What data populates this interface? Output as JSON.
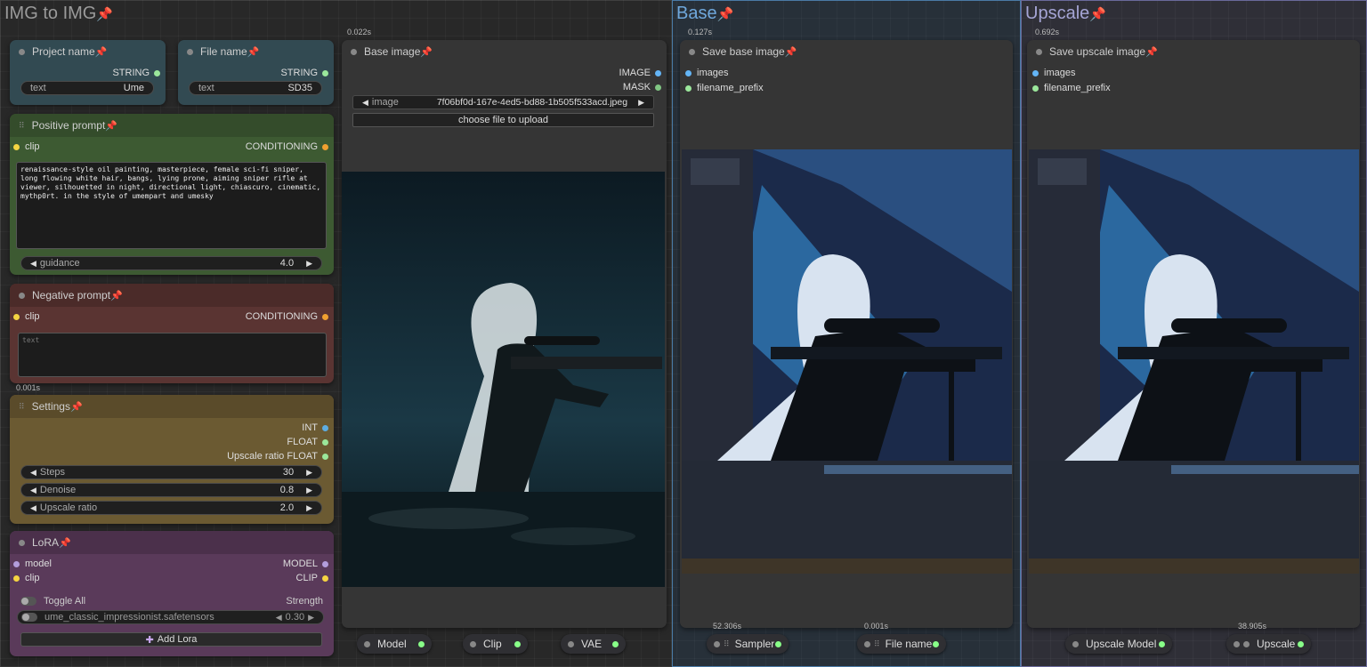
{
  "groups": {
    "img2img": {
      "title": "IMG to IMG"
    },
    "base": {
      "title": "Base"
    },
    "upscale": {
      "title": "Upscale"
    }
  },
  "timings": {
    "base_image": "0.022s",
    "save_base": "0.127s",
    "save_upscale": "0.692s",
    "negative": "0.001s",
    "sampler": "52.306s",
    "file_name_chip": "0.001s",
    "upscale_chip": "38.905s"
  },
  "project_name": {
    "title": "Project name",
    "output": "STRING",
    "label": "text",
    "value": "Ume"
  },
  "file_name": {
    "title": "File name",
    "output": "STRING",
    "label": "text",
    "value": "SD35"
  },
  "positive": {
    "title": "Positive prompt",
    "input": "clip",
    "output": "CONDITIONING",
    "text": "renaissance-style oil painting, masterpiece, female sci-fi sniper, long flowing white hair, bangs, lying prone, aiming sniper rifle at viewer, silhouetted in night, directional light, chiascuro, cinematic, mythp0rt. in the style of umempart and umesky",
    "guidance_label": "guidance",
    "guidance_value": "4.0"
  },
  "negative": {
    "title": "Negative prompt",
    "input": "clip",
    "output": "CONDITIONING",
    "placeholder": "text"
  },
  "settings": {
    "title": "Settings",
    "outputs": [
      "INT",
      "FLOAT",
      "Upscale ratio FLOAT"
    ],
    "steps_label": "Steps",
    "steps_value": "30",
    "denoise_label": "Denoise",
    "denoise_value": "0.8",
    "ratio_label": "Upscale ratio",
    "ratio_value": "2.0"
  },
  "lora": {
    "title": "LoRA",
    "in_model": "model",
    "in_clip": "clip",
    "out_model": "MODEL",
    "out_clip": "CLIP",
    "toggle_all": "Toggle All",
    "strength": "Strength",
    "item_name": "ume_classic_impressionist.safetensors",
    "item_value": "0.30",
    "add": "Add Lora"
  },
  "base_image": {
    "title": "Base image",
    "out_image": "IMAGE",
    "out_mask": "MASK",
    "image_label": "image",
    "image_value": "7f06bf0d-167e-4ed5-bd88-1b505f533acd.jpeg",
    "upload": "choose file to upload"
  },
  "save_base": {
    "title": "Save base image",
    "in_images": "images",
    "in_prefix": "filename_prefix"
  },
  "save_upscale": {
    "title": "Save upscale image",
    "in_images": "images",
    "in_prefix": "filename_prefix"
  },
  "chips": {
    "model": "Model",
    "clip": "Clip",
    "vae": "VAE",
    "sampler": "Sampler",
    "file_name": "File name",
    "upscale_model": "Upscale Model",
    "upscale": "Upscale"
  },
  "colors": {
    "clip_slot": "#f5d442",
    "conditioning_slot": "#f0a030",
    "image_slot": "#64b5f6",
    "mask_slot": "#81c784",
    "float_slot": "#9be79b",
    "int_slot": "#5dade2",
    "model_slot": "#b39ddb",
    "positive_bg": "#3d5a32",
    "negative_bg": "#5a3432",
    "settings_bg": "#6b5a32",
    "lora_bg": "#5a3a5a",
    "string_bg": "#324a52"
  }
}
